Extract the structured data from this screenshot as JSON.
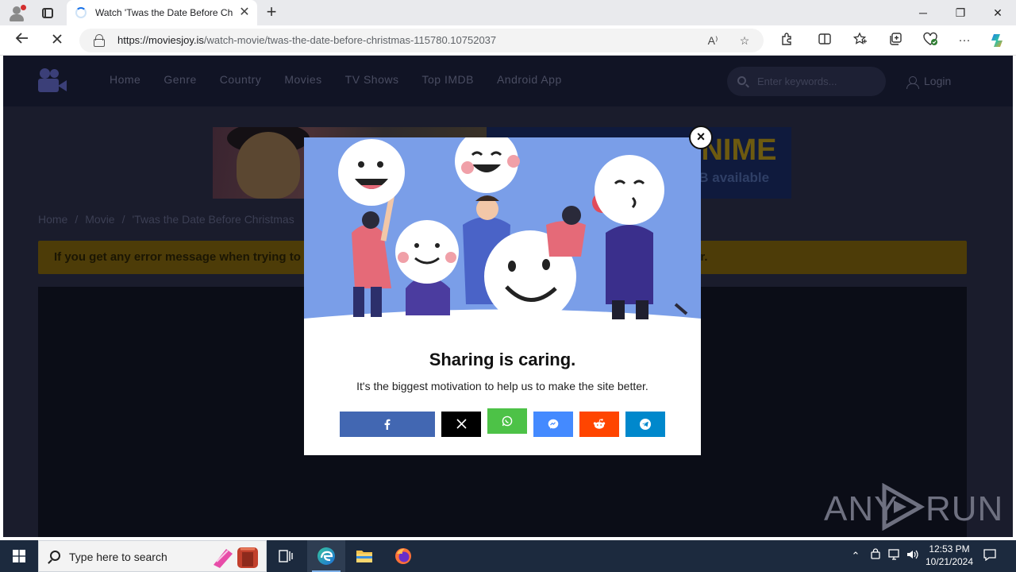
{
  "browser": {
    "tab_title": "Watch 'Twas the Date Before Christmas",
    "new_tab": "+",
    "url_host": "https://moviesjoy.is",
    "url_path": "/watch-movie/twas-the-date-before-christmas-115780.10752037",
    "window_controls": {
      "minimize": "─",
      "maximize": "❐",
      "close": "✕"
    },
    "icons": [
      "back-icon",
      "stop-icon",
      "lock-icon",
      "read-aloud-icon",
      "favorite-star-icon",
      "extensions-icon",
      "split-screen-icon",
      "favorites-icon",
      "collections-icon",
      "browser-essentials-icon",
      "more-icon",
      "copilot-icon"
    ]
  },
  "site": {
    "nav": [
      "Home",
      "Genre",
      "Country",
      "Movies",
      "TV Shows",
      "Top IMDB",
      "Android App"
    ],
    "search_placeholder": "Enter keywords...",
    "login": "Login",
    "banner": {
      "headline": "ANIME",
      "subline": "UB available"
    },
    "breadcrumb": [
      "Home",
      "Movie",
      "'Twas the Date Before Christmas"
    ],
    "breadcrumb_sep": "/",
    "notice_left": "If you get any error message when trying to",
    "notice_right": "er."
  },
  "modal": {
    "title": "Sharing is caring.",
    "subtitle": "It's the biggest motivation to help us to make the site better.",
    "close_label": "×",
    "share_buttons": [
      {
        "name": "facebook",
        "color": "#4267b2"
      },
      {
        "name": "x",
        "color": "#000000"
      },
      {
        "name": "whatsapp",
        "color": "#4dc247"
      },
      {
        "name": "messenger",
        "color": "#448aff"
      },
      {
        "name": "reddit",
        "color": "#ff4500"
      },
      {
        "name": "telegram",
        "color": "#0088cc"
      }
    ]
  },
  "watermark": {
    "left": "ANY",
    "right": "RUN"
  },
  "taskbar": {
    "search_placeholder": "Type here to search",
    "time": "12:53 PM",
    "date": "10/21/2024"
  },
  "colors": {
    "site_bg": "#1a1c2c",
    "header_bg": "#111425",
    "notice_bg": "#4d3c08",
    "taskbar_bg": "#1c2a3e",
    "illustration_bg": "#7a9ee8"
  }
}
